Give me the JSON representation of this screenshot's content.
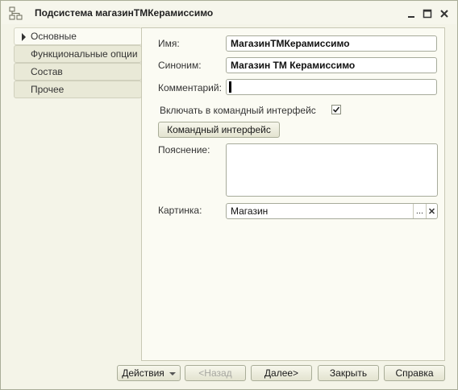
{
  "window": {
    "title": "Подсистема магазинТМКерамиссимо"
  },
  "tabs": [
    {
      "label": "Основные",
      "active": true
    },
    {
      "label": "Функциональные опции",
      "active": false
    },
    {
      "label": "Состав",
      "active": false
    },
    {
      "label": "Прочее",
      "active": false
    }
  ],
  "form": {
    "name_label": "Имя:",
    "name_value": "МагазинТМКерамиссимо",
    "synonym_label": "Синоним:",
    "synonym_value": "Магазин ТМ Керамиссимо",
    "comment_label": "Комментарий:",
    "comment_value": "",
    "include_label": "Включать в командный интерфейс",
    "include_checked": true,
    "command_interface_button": "Командный интерфейс",
    "explanation_label": "Пояснение:",
    "explanation_value": "",
    "picture_label": "Картинка:",
    "picture_value": "Магазин",
    "picture_select_glyph": "...",
    "picture_clear_glyph": "✕"
  },
  "footer": {
    "actions_label": "Действия",
    "back_label": "<Назад",
    "next_label": "Далее>",
    "close_label": "Закрыть",
    "help_label": "Справка"
  },
  "colors": {
    "window_bg": "#f4f4e8",
    "panel_bg": "#fbfbf3",
    "tab_bg": "#e9e9d7",
    "border": "#a9ad98"
  },
  "icons": {
    "app": "subsystem-icon",
    "minimize": "minimize-icon",
    "maximize": "maximize-icon",
    "close": "close-icon",
    "check": "check-icon",
    "tab_arrow": "triangle-right-icon"
  }
}
